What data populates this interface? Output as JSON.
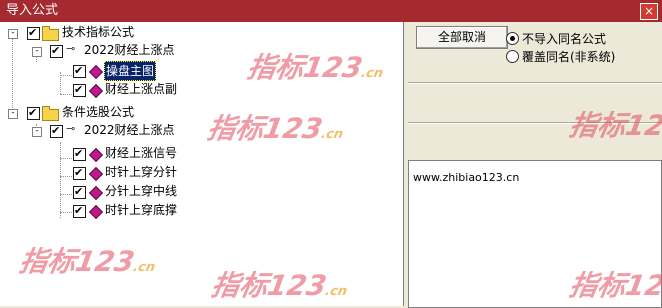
{
  "window": {
    "title": "导入公式",
    "close_glyph": "×"
  },
  "tree": {
    "nodes": [
      {
        "label": "技术指标公式",
        "kind": "folder",
        "expand": "-"
      },
      {
        "label": "2022财经上涨点",
        "kind": "formula",
        "expand": "-"
      },
      {
        "label": "操盘主图",
        "kind": "item",
        "selected": true
      },
      {
        "label": "财经上涨点副",
        "kind": "item"
      },
      {
        "label": "条件选股公式",
        "kind": "folder",
        "expand": "-"
      },
      {
        "label": "2022财经上涨点",
        "kind": "formula",
        "expand": "-"
      },
      {
        "label": "财经上涨信号",
        "kind": "item"
      },
      {
        "label": "时针上穿分针",
        "kind": "item"
      },
      {
        "label": "分针上穿中线",
        "kind": "item"
      },
      {
        "label": "时针上穿底撑",
        "kind": "item"
      }
    ]
  },
  "right": {
    "cancel_all_label": "全部取消",
    "options": [
      {
        "label": "不导入同名公式",
        "selected": true
      },
      {
        "label": "覆盖同名(非系统)",
        "selected": false
      }
    ],
    "description": "www.zhibiao123.cn"
  },
  "watermark": {
    "text": "指标123",
    "suffix": ".cn"
  },
  "colors": {
    "titlebar": "#a52a2f",
    "selection": "#0a246a",
    "watermark": "#e34a5c"
  }
}
